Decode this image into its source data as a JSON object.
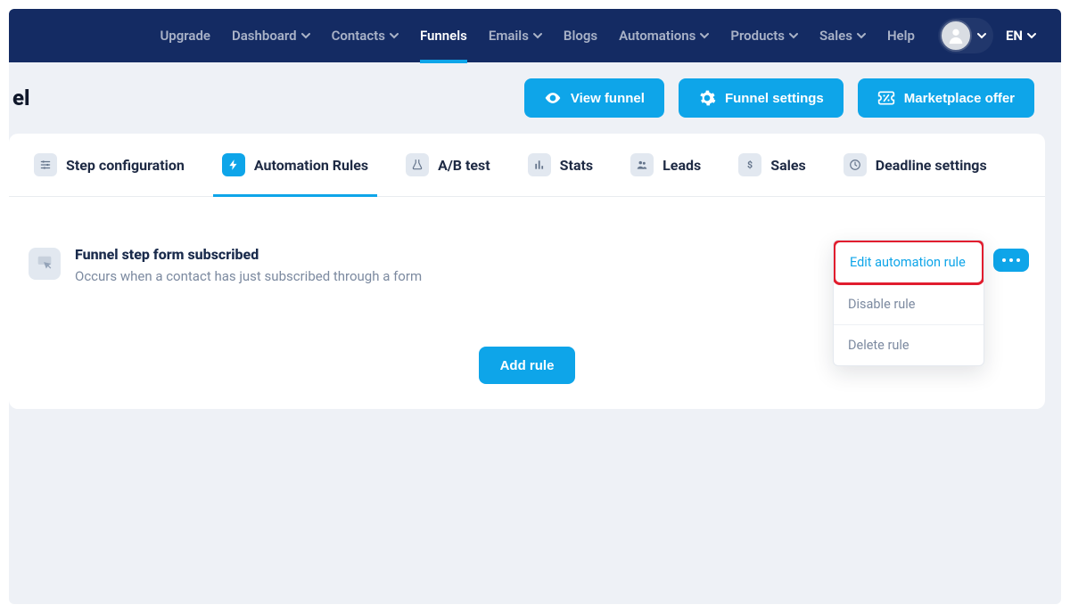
{
  "nav": {
    "items": [
      {
        "label": "Upgrade",
        "caret": false
      },
      {
        "label": "Dashboard",
        "caret": true
      },
      {
        "label": "Contacts",
        "caret": true
      },
      {
        "label": "Funnels",
        "caret": false,
        "active": true
      },
      {
        "label": "Emails",
        "caret": true
      },
      {
        "label": "Blogs",
        "caret": false
      },
      {
        "label": "Automations",
        "caret": true
      },
      {
        "label": "Products",
        "caret": true
      },
      {
        "label": "Sales",
        "caret": true
      },
      {
        "label": "Help",
        "caret": false
      }
    ],
    "language": "EN"
  },
  "page": {
    "title_fragment": "el"
  },
  "actions": {
    "view_funnel": "View funnel",
    "funnel_settings": "Funnel settings",
    "marketplace_offer": "Marketplace offer"
  },
  "tabs": [
    {
      "label": "Step configuration"
    },
    {
      "label": "Automation Rules",
      "active": true
    },
    {
      "label": "A/B test"
    },
    {
      "label": "Stats"
    },
    {
      "label": "Leads"
    },
    {
      "label": "Sales"
    },
    {
      "label": "Deadline settings"
    }
  ],
  "rule": {
    "title": "Funnel step form subscribed",
    "subtitle": "Occurs when a contact has just subscribed through a form"
  },
  "dropdown": {
    "edit": "Edit automation rule",
    "disable": "Disable rule",
    "delete": "Delete rule"
  },
  "buttons": {
    "add_rule": "Add rule"
  },
  "colors": {
    "navbar": "#142b63",
    "accent": "#0ea5e9",
    "highlight_border": "#e11d2e"
  }
}
